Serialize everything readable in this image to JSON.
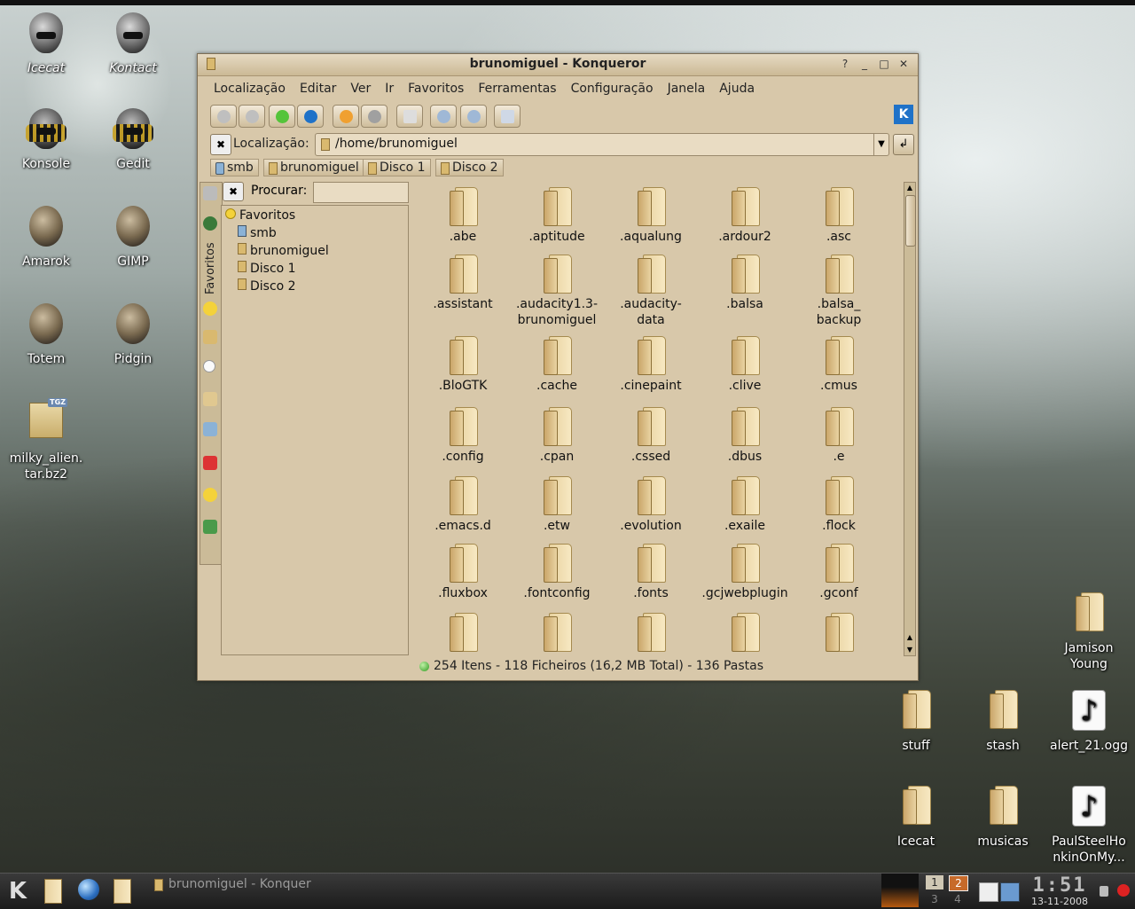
{
  "desktop": {
    "icons_left": [
      {
        "label": "Icecat",
        "italic": true,
        "type": "alien"
      },
      {
        "label": "Kontact",
        "italic": true,
        "type": "alien"
      },
      {
        "label": "Konsole",
        "type": "predator"
      },
      {
        "label": "Gedit",
        "type": "predator"
      },
      {
        "label": "Amarok",
        "type": "alien2"
      },
      {
        "label": "GIMP",
        "type": "alien2"
      },
      {
        "label": "Totem",
        "type": "sphere"
      },
      {
        "label": "Pidgin",
        "type": "sphere"
      },
      {
        "label": "milky_alien.\ntar.bz2",
        "type": "tgz",
        "badge": "TGZ"
      }
    ],
    "icons_right": [
      {
        "label": "Jamison Young",
        "type": "folder"
      },
      {
        "label": "stuff",
        "type": "folder"
      },
      {
        "label": "stash",
        "type": "folder"
      },
      {
        "label": "alert_21.ogg",
        "type": "audio"
      },
      {
        "label": "Icecat",
        "type": "folder"
      },
      {
        "label": "musicas",
        "type": "folder"
      },
      {
        "label": "PaulSteelHonkinOnMy...",
        "type": "audio"
      }
    ],
    "right_labels": {
      "jamison": "Jamison\nYoung",
      "paul": "PaulSteelHo\nnkinOnMy..."
    }
  },
  "window": {
    "title": "brunomiguel - Konqueror",
    "buttons": {
      "help": "?",
      "minimize": "_",
      "maximize": "□",
      "close": "✕"
    },
    "menu": [
      "Localização",
      "Editar",
      "Ver",
      "Ir",
      "Favoritos",
      "Ferramentas",
      "Configuração",
      "Janela",
      "Ajuda"
    ],
    "location_label": "Localização:",
    "location_value": "/home/brunomiguel",
    "bookmarks": [
      "smb",
      "brunomiguel",
      "Disco 1",
      "Disco 2"
    ],
    "side_tab_label": "Favoritos",
    "search_label": "Procurar:",
    "tree": {
      "root": "Favoritos",
      "items": [
        "smb",
        "brunomiguel",
        "Disco 1",
        "Disco 2"
      ]
    },
    "files": [
      ".abe",
      ".aptitude",
      ".aqualung",
      ".ardour2",
      ".asc",
      ".assistant",
      ".audacity1.3-\nbrunomiguel",
      ".audacity-\ndata",
      ".balsa",
      ".balsa_\nbackup",
      ".BloGTK",
      ".cache",
      ".cinepaint",
      ".clive",
      ".cmus",
      ".config",
      ".cpan",
      ".cssed",
      ".dbus",
      ".e",
      ".emacs.d",
      ".etw",
      ".evolution",
      ".exaile",
      ".flock",
      ".fluxbox",
      ".fontconfig",
      ".fonts",
      ".gcjwebplugin",
      ".gconf",
      "",
      "",
      "",
      "",
      ""
    ],
    "status": "254 Itens - 118 Ficheiros (16,2 MB Total) - 136 Pastas"
  },
  "taskbar": {
    "task_label": "brunomiguel - Konquer",
    "pager": [
      "1",
      "2",
      "3",
      "4"
    ],
    "clock_time": "1:51",
    "clock_date": "13-11-2008"
  },
  "colors": {
    "window_bg": "#d8c8aa",
    "accent_blue": "#1f72c8"
  }
}
